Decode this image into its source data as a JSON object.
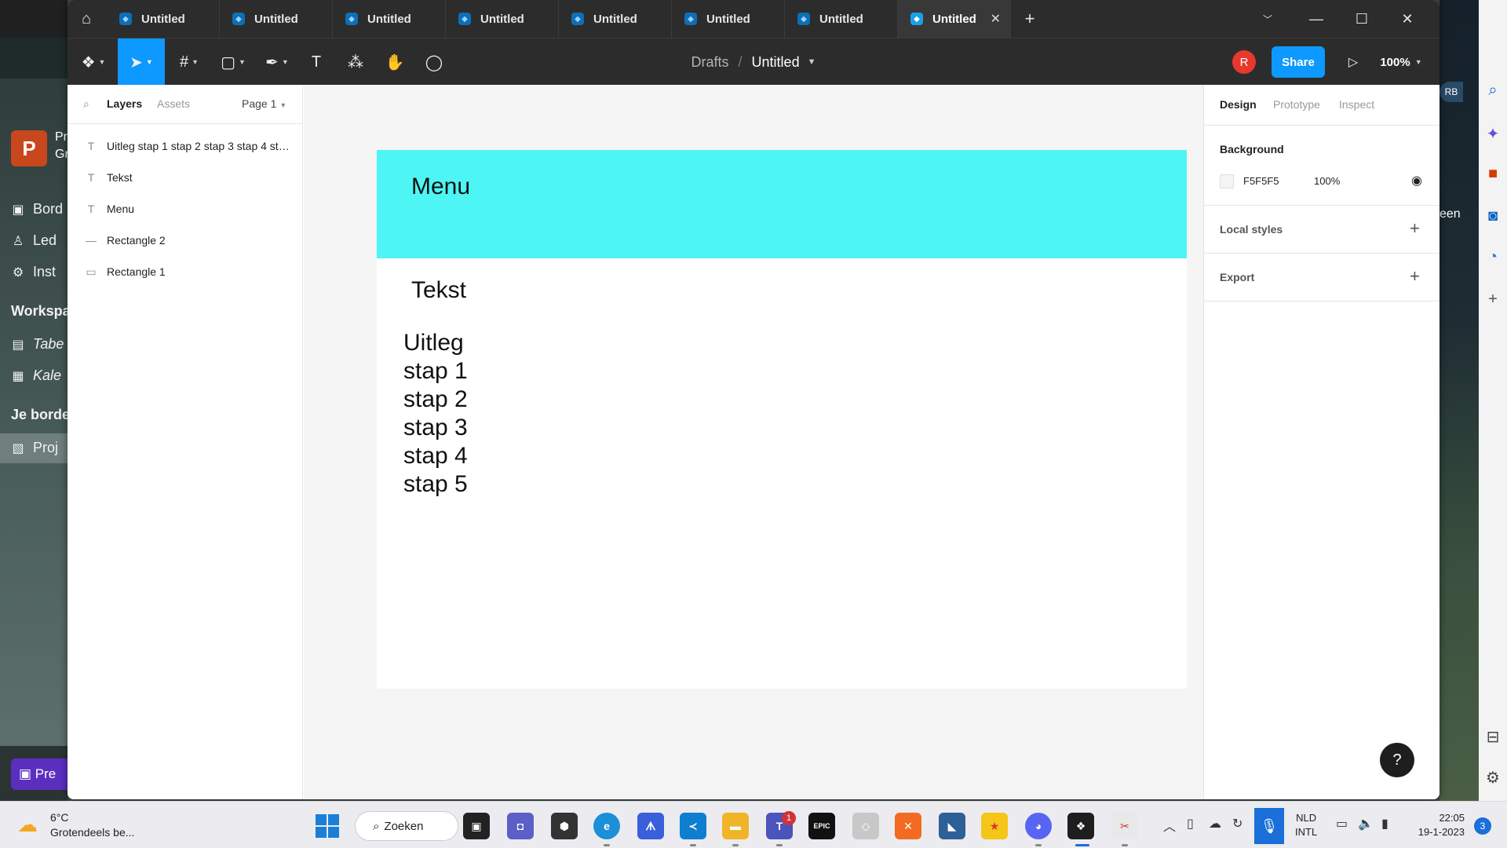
{
  "background_app": {
    "left_items": [
      {
        "label": "Bord",
        "icon": "board-icon"
      },
      {
        "label": "Led",
        "icon": "person-icon"
      },
      {
        "label": "Inst",
        "icon": "gear-icon"
      }
    ],
    "pp_badge": "P",
    "pp_text_1": "Pr",
    "pp_text_2": "Gr",
    "workspace_heading": "Workspa",
    "workspace_items": [
      {
        "label": "Tabe",
        "icon": "table-icon"
      },
      {
        "label": "Kale",
        "icon": "calendar-icon"
      }
    ],
    "boards_heading": "Je border",
    "selected_board": "Proj",
    "premium_label": "Pre",
    "right_badge": "RB",
    "right_text": "een"
  },
  "window": {
    "tabs": [
      {
        "label": "Untitled",
        "active": false
      },
      {
        "label": "Untitled",
        "active": false
      },
      {
        "label": "Untitled",
        "active": false
      },
      {
        "label": "Untitled",
        "active": false
      },
      {
        "label": "Untitled",
        "active": false
      },
      {
        "label": "Untitled",
        "active": false
      },
      {
        "label": "Untitled",
        "active": false
      },
      {
        "label": "Untitled",
        "active": true
      }
    ],
    "breadcrumb": {
      "parent": "Drafts",
      "separator": "/",
      "file": "Untitled"
    },
    "avatar_initial": "R",
    "share_label": "Share",
    "zoom": "100%"
  },
  "left_panel": {
    "tab_layers": "Layers",
    "tab_assets": "Assets",
    "page_selector": "Page 1",
    "layers": [
      {
        "label": "Uitleg stap 1 stap 2 stap 3 stap 4 stap 5",
        "type": "text"
      },
      {
        "label": "Tekst",
        "type": "text"
      },
      {
        "label": "Menu",
        "type": "text"
      },
      {
        "label": "Rectangle 2",
        "type": "line"
      },
      {
        "label": "Rectangle 1",
        "type": "rectangle"
      }
    ]
  },
  "canvas": {
    "menu_text": "Menu",
    "tekst_text": "Tekst",
    "uitleg_text": "Uitleg\nstap 1\nstap 2\nstap 3\nstap 4\nstap 5",
    "menu_color": "#4ef5f5",
    "canvas_color": "#f5f5f5"
  },
  "right_panel": {
    "tabs": [
      "Design",
      "Prototype",
      "Inspect"
    ],
    "active_tab": "Design",
    "background_title": "Background",
    "background_hex": "F5F5F5",
    "background_opacity": "100%",
    "local_styles": "Local styles",
    "export": "Export",
    "help": "?"
  },
  "taskbar": {
    "weather_temp": "6°C",
    "weather_desc": "Grotendeels be...",
    "search": "Zoeken",
    "teams_badge": "1",
    "lang_1": "NLD",
    "lang_2": "INTL",
    "time": "22:05",
    "date": "19-1-2023",
    "notifications": "3"
  }
}
